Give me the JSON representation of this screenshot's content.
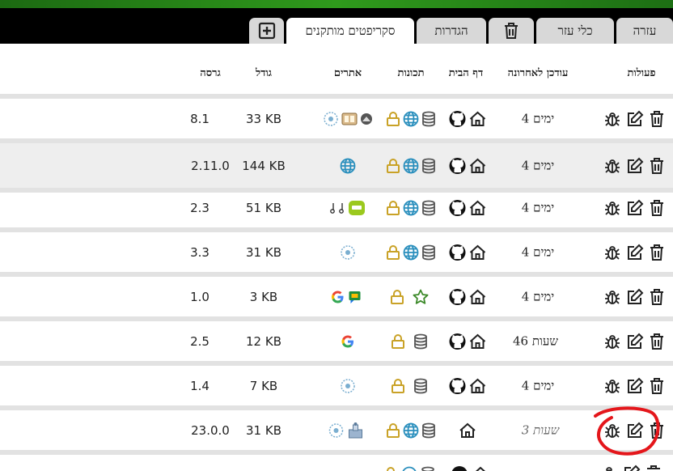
{
  "tabs": [
    {
      "label": "עזרה"
    },
    {
      "label": "כלי עזר"
    },
    {
      "label": "הגדרות"
    },
    {
      "label": "סקריפטים מותקנים"
    }
  ],
  "tab_icons": {
    "trash": "trash-icon",
    "add": "plus-square-icon"
  },
  "headers": {
    "actions": "פעולות",
    "updated": "עודכן לאחרונה",
    "homepage": "דף הבית",
    "features": "תכונות",
    "sites": "אתרים",
    "size": "גודל",
    "version": "גרסה"
  },
  "colors": {
    "tabbar": "#000000",
    "accent_green": "#2f9a1c",
    "highlight_circle": "#e4161b",
    "globe": "#2a8fbd",
    "lock": "#c9a227"
  },
  "rows": [
    {
      "version": "8.1",
      "size": "33 KB",
      "updated": "4 ימים"
    },
    {
      "version": "2.11.0",
      "size": "144 KB",
      "updated": "4 ימים"
    },
    {
      "version": "2.3",
      "size": "51 KB",
      "updated": "4 ימים"
    },
    {
      "version": "3.3",
      "size": "31 KB",
      "updated": "4 ימים"
    },
    {
      "version": "1.0",
      "size": "3 KB",
      "updated": "4 ימים"
    },
    {
      "version": "2.5",
      "size": "12 KB",
      "updated": "46 שעות"
    },
    {
      "version": "1.4",
      "size": "7 KB",
      "updated": "4 ימים"
    },
    {
      "version": "23.0.0",
      "size": "31 KB",
      "updated": "3 שעות"
    },
    {
      "version": "",
      "size": "",
      "updated": ""
    }
  ]
}
